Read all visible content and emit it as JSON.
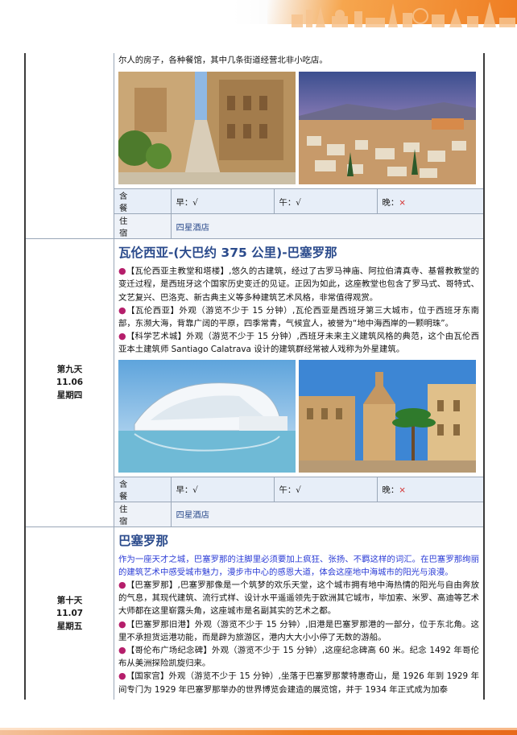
{
  "header": {
    "banner": "orange-gradient-city-skyline"
  },
  "day8_continued": {
    "tail_text": "尔人的房子，各种餐馆，其中几条街道经营北非小吃店。",
    "photos": [
      "cordoba-mezquita-street-photo",
      "granada-albaicin-sunset-photo"
    ],
    "meals": {
      "label": "含 餐",
      "breakfast": "早：√",
      "lunch": "午：√",
      "dinner_prefix": "晚：",
      "dinner_mark": "×"
    },
    "lodging": {
      "label": "住 宿",
      "hotel": "四星酒店"
    }
  },
  "day9": {
    "day_label": "第九天",
    "date": "11.06",
    "weekday": "星期四",
    "title": "瓦伦西亚-(大巴约 375 公里)-巴塞罗那",
    "bullet": "●",
    "items": [
      "【瓦伦西亚主教堂和塔楼】,悠久的古建筑，经过了古罗马神庙、阿拉伯清真寺、基督教教堂的变迁过程，是西班牙这个国家历史变迁的见证。正因为如此，这座教堂也包含了罗马式、哥特式、文艺复兴、巴洛克、新古典主义等多种建筑艺术风格，非常值得观赏。",
      "【瓦伦西亚】外观（游览不少于 15 分钟）,瓦伦西亚是西班牙第三大城市，位于西班牙东南部，东濒大海，背靠广阔的平原，四季常青，气候宜人，被誉为“地中海西岸的一颗明珠”。",
      "【科学艺术城】外观（游览不少于 15 分钟）,西班牙未来主义建筑风格的典范，这个由瓦伦西亚本土建筑师 Santiago Calatrava 设计的建筑群经常被人戏称为外星建筑。"
    ],
    "photos": [
      "city-of-arts-and-sciences-photo",
      "valencia-cathedral-plaza-photo"
    ],
    "meals": {
      "label": "含 餐",
      "breakfast": "早：√",
      "lunch": "午：√",
      "dinner_prefix": "晚：",
      "dinner_mark": "×"
    },
    "lodging": {
      "label": "住 宿",
      "hotel": "四星酒店"
    }
  },
  "day10": {
    "day_label": "第十天",
    "date": "11.07",
    "weekday": "星期五",
    "title": "巴塞罗那",
    "intro": "作为一座天才之城，巴塞罗那的注脚里必须要加上疯狂、张扬、不羁这样的词汇。在巴塞罗那绚丽的建筑艺术中感受城市魅力，漫步市中心的感恩大道，体会这座地中海城市的阳光与浪漫。",
    "bullet": "●",
    "items": [
      "【巴塞罗那】,巴塞罗那像是一个筑梦的欢乐天堂，这个城市拥有地中海热情的阳光与自由奔放的气息，其现代建筑、流行式样、设计水平遥遥领先于欧洲其它城市，毕加索、米罗、高迪等艺术大师都在这里崭露头角，这座城市是名副其实的艺术之都。",
      "【巴塞罗那旧港】外观（游览不少于 15 分钟）,旧港是巴塞罗那港的一部分，位于东北角。这里不承担货运港功能，而是辟为旅游区，港内大大小小停了无数的游船。",
      "【哥伦布广场纪念碑】外观（游览不少于 15 分钟）,这座纪念碑高 60 米。纪念 1492 年哥伦布从美洲探险凯旋归来。",
      "【国家宫】外观（游览不少于 15 分钟）,坐落于巴塞罗那蒙特惠奇山，是 1926 年到 1929 年间专门为 1929 年巴塞罗那举办的世界博览会建造的展览馆，并于 1934 年正式成为加泰"
    ]
  },
  "colors": {
    "accent_orange": "#ef7d22",
    "title_blue": "#2b4b8c",
    "intro_blue": "#2a3bd6",
    "bullet_magenta": "#b51e6b",
    "table_fill": "#e7eef8",
    "cross_red": "#d42a2a"
  }
}
